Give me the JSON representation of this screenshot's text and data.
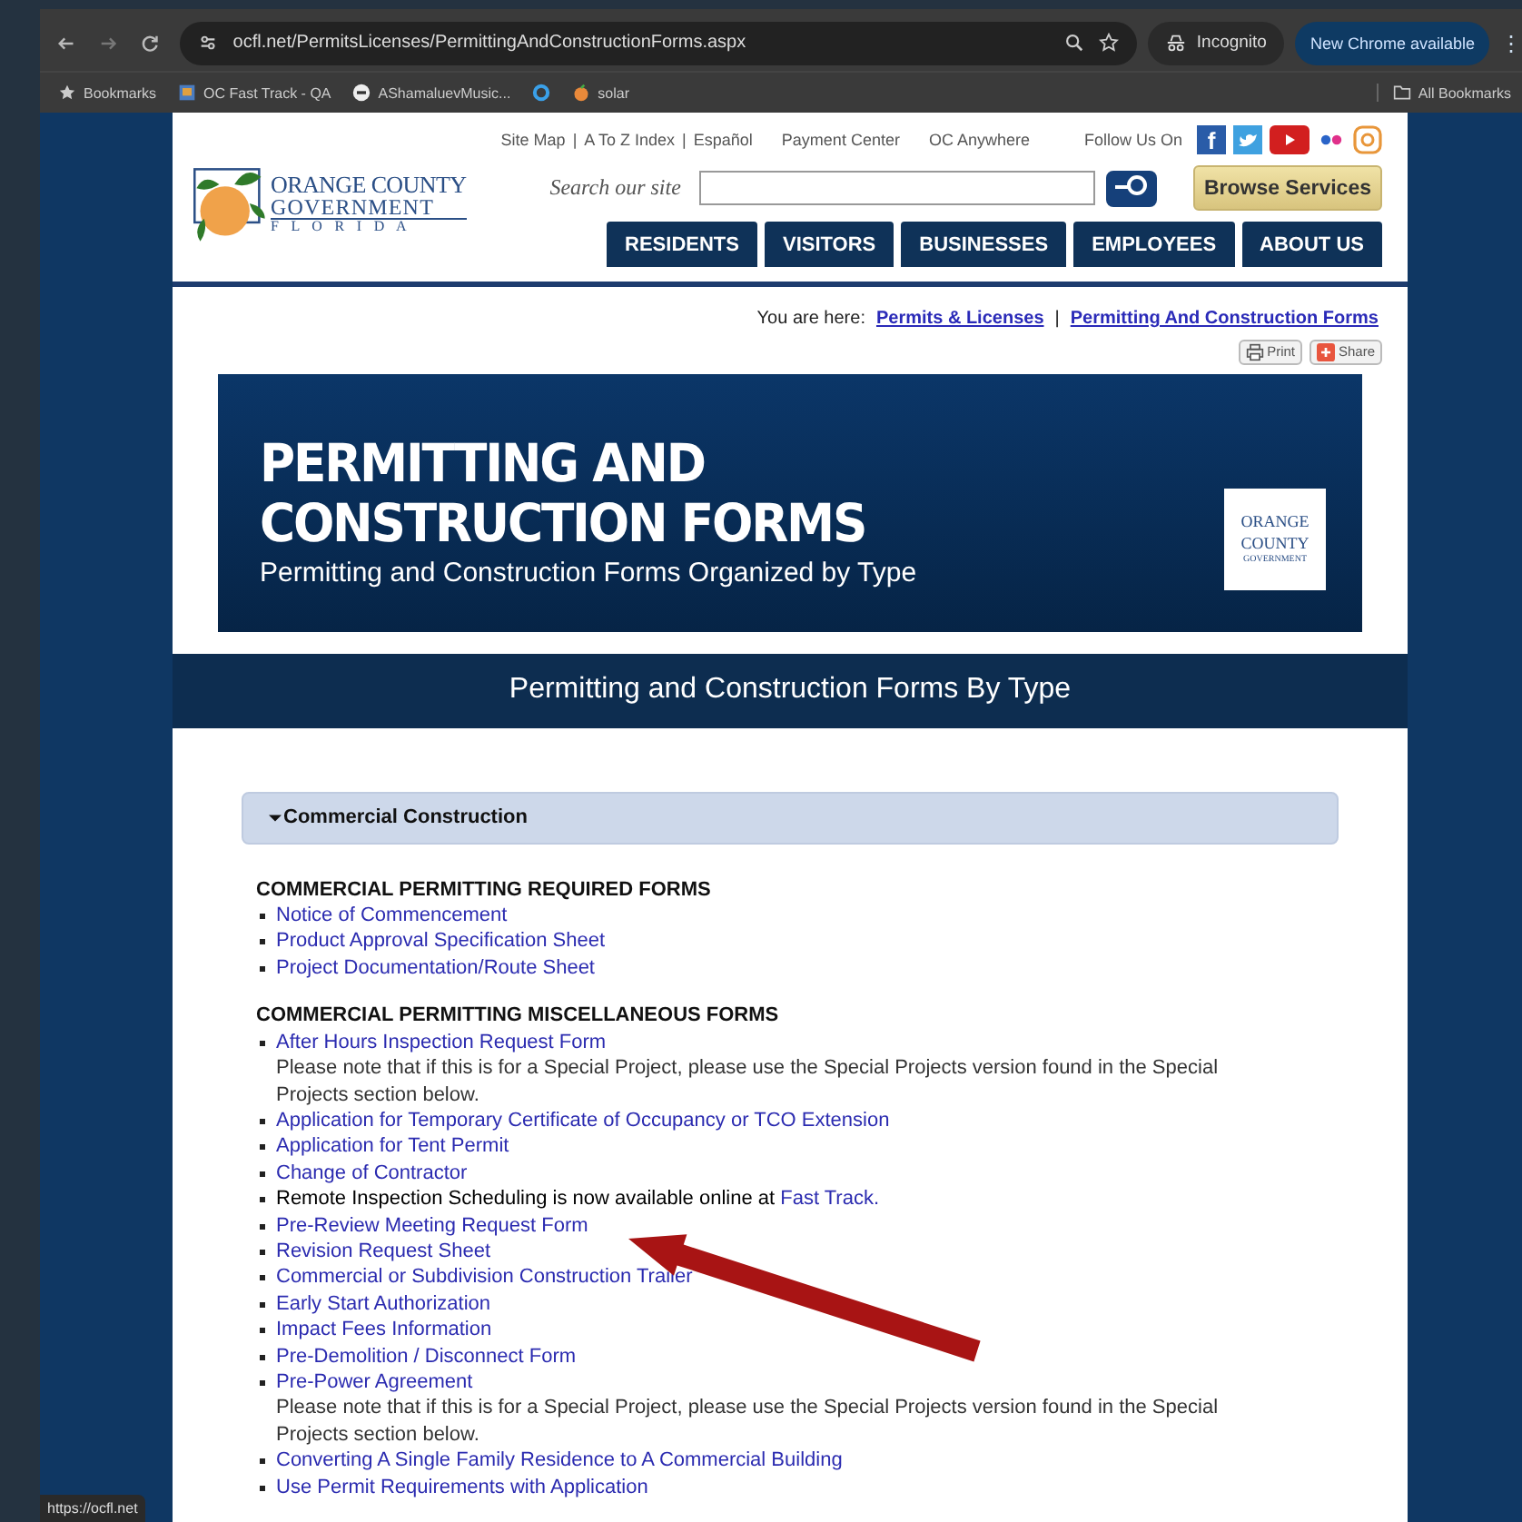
{
  "browser": {
    "url": "ocfl.net/PermitsLicenses/PermittingAndConstructionForms.aspx",
    "incognito": "Incognito",
    "update": "New Chrome available",
    "menu": "⋮",
    "bookmarks": [
      {
        "label": "Bookmarks",
        "kind": "star"
      },
      {
        "label": "OC Fast Track - QA",
        "kind": "page"
      },
      {
        "label": "AShamaluevMusic...",
        "kind": "dash"
      },
      {
        "kind": "ring"
      },
      {
        "label": "solar",
        "kind": "fruit"
      }
    ],
    "all_bookmarks": "All Bookmarks",
    "status": "https://ocfl.net"
  },
  "header": {
    "logo": {
      "line1": "ORANGE COUNTY",
      "line2": "GOVERNMENT",
      "line3": "F L O R I D A"
    },
    "top_links": [
      "Site Map",
      "A To Z Index",
      "Español"
    ],
    "top_separator": "|",
    "extra_links": [
      "Payment Center",
      "OC Anywhere"
    ],
    "follow": "Follow Us On",
    "facebook": "f",
    "search_label": "Search our site",
    "browse": "Browse Services",
    "nav": [
      {
        "label": "RESIDENTS"
      },
      {
        "label": "VISITORS"
      },
      {
        "label": "BUSINESSES"
      },
      {
        "label": "EMPLOYEES"
      },
      {
        "label": "ABOUT US"
      }
    ]
  },
  "breadcrumb": {
    "prefix": "You are here:",
    "separator": "|",
    "links": [
      "Permits & Licenses",
      "Permitting And Construction Forms"
    ]
  },
  "tools": [
    "Print",
    "Share"
  ],
  "banner": {
    "title_lines": [
      "PERMITTING AND",
      "CONSTRUCTION FORMS"
    ],
    "subtitle": "Permitting and Construction Forms Organized by Type",
    "logo_lines": [
      "ORANGE",
      "COUNTY",
      "GOVERNMENT"
    ]
  },
  "section_title": "Permitting and Construction Forms By Type",
  "accordion": {
    "label": "Commercial Construction",
    "expanded": true
  },
  "groups": [
    {
      "heading": "COMMERCIAL PERMITTING REQUIRED FORMS",
      "items": [
        {
          "kind": "link",
          "text": "Notice of Commencement"
        },
        {
          "kind": "link",
          "text": "Product Approval Specification Sheet"
        },
        {
          "kind": "link",
          "text": "Project Documentation/Route Sheet"
        }
      ]
    },
    {
      "heading": "COMMERCIAL PERMITTING MISCELLANEOUS FORMS",
      "items": [
        {
          "kind": "link",
          "text": "After Hours Inspection Request Form",
          "note": "Please note that if this is for a Special Project, please use the Special Projects version found in the Special Projects section below."
        },
        {
          "kind": "link",
          "text": "Application for Temporary Certificate of Occupancy or TCO Extension"
        },
        {
          "kind": "link",
          "text": "Application for Tent Permit"
        },
        {
          "kind": "link",
          "text": "Change of Contractor"
        },
        {
          "kind": "mixed",
          "text": "Remote Inspection Scheduling is now available online at",
          "link": "Fast Track."
        },
        {
          "kind": "link",
          "text": "Pre-Review Meeting Request Form"
        },
        {
          "kind": "link",
          "text": "Revision Request Sheet"
        },
        {
          "kind": "link",
          "text": "Commercial or Subdivision Construction Trailer"
        },
        {
          "kind": "link",
          "text": "Early Start Authorization"
        },
        {
          "kind": "link",
          "text": "Impact Fees Information"
        },
        {
          "kind": "link",
          "text": "Pre-Demolition / Disconnect Form"
        },
        {
          "kind": "link",
          "text": "Pre-Power Agreement",
          "note": "Please note that if this is for a Special Project, please use the Special Projects version found in the Special Projects section below."
        },
        {
          "kind": "link",
          "text": "Converting A Single Family Residence to A Commercial Building"
        },
        {
          "kind": "link",
          "text": "Use Permit Requirements with Application"
        }
      ]
    }
  ]
}
